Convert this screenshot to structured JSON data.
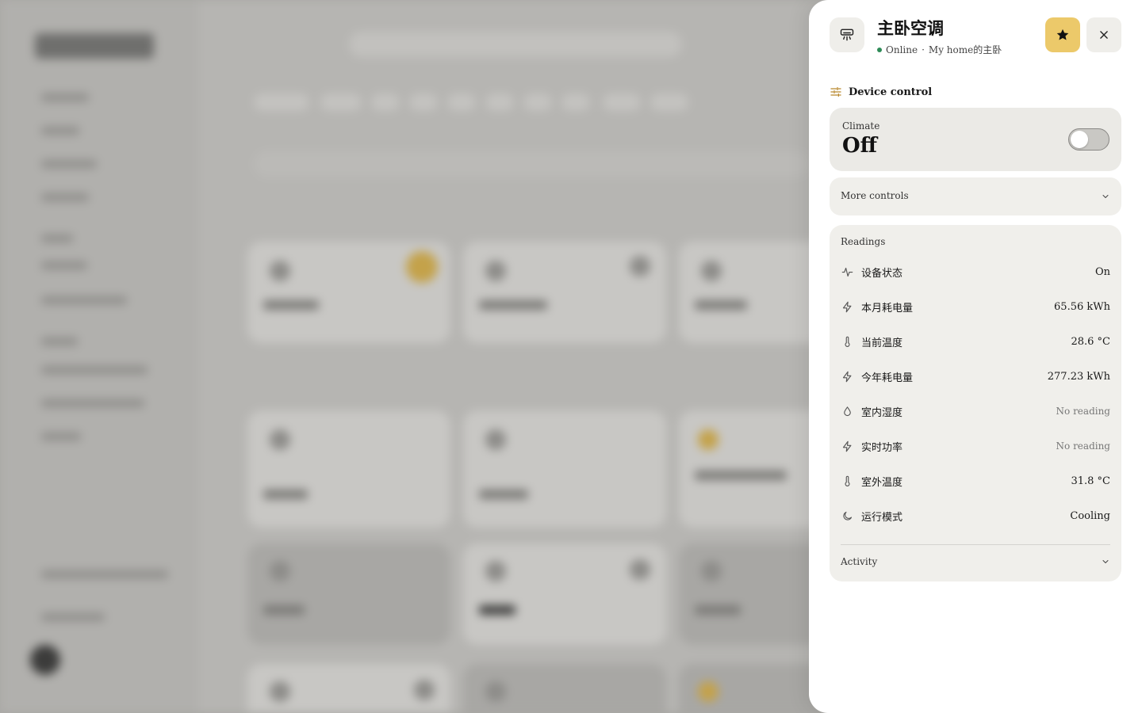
{
  "device": {
    "name": "主卧空调",
    "status": "Online",
    "location": "My home的主卧",
    "icon": "air-conditioner-icon"
  },
  "header": {
    "favorite_icon": "star-icon",
    "close_icon": "close-icon",
    "favorite_color": "#ecc96a"
  },
  "control": {
    "section_title": "Device control",
    "section_icon": "sliders-icon",
    "climate_label": "Climate",
    "climate_state": "Off",
    "climate_on": false,
    "more_controls_label": "More controls"
  },
  "readings": {
    "title": "Readings",
    "rows": [
      {
        "name": "设备状态",
        "value": "On",
        "icon": "activity-icon",
        "muted": false
      },
      {
        "name": "本月耗电量",
        "value": "65.56 kWh",
        "icon": "bolt-icon",
        "muted": false
      },
      {
        "name": "当前温度",
        "value": "28.6 °C",
        "icon": "thermometer-icon",
        "muted": false
      },
      {
        "name": "今年耗电量",
        "value": "277.23 kWh",
        "icon": "bolt-icon",
        "muted": false
      },
      {
        "name": "室内湿度",
        "value": "No reading",
        "icon": "droplet-icon",
        "muted": true
      },
      {
        "name": "实时功率",
        "value": "No reading",
        "icon": "bolt-icon",
        "muted": true
      },
      {
        "name": "室外温度",
        "value": "31.8 °C",
        "icon": "thermometer-icon",
        "muted": false
      },
      {
        "name": "运行模式",
        "value": "Cooling",
        "icon": "moon-icon",
        "muted": false
      }
    ],
    "activity_label": "Activity"
  },
  "colors": {
    "online": "#2e8b57",
    "card_bg": "#f0efeb",
    "climate_card_bg": "#ebeae6"
  }
}
